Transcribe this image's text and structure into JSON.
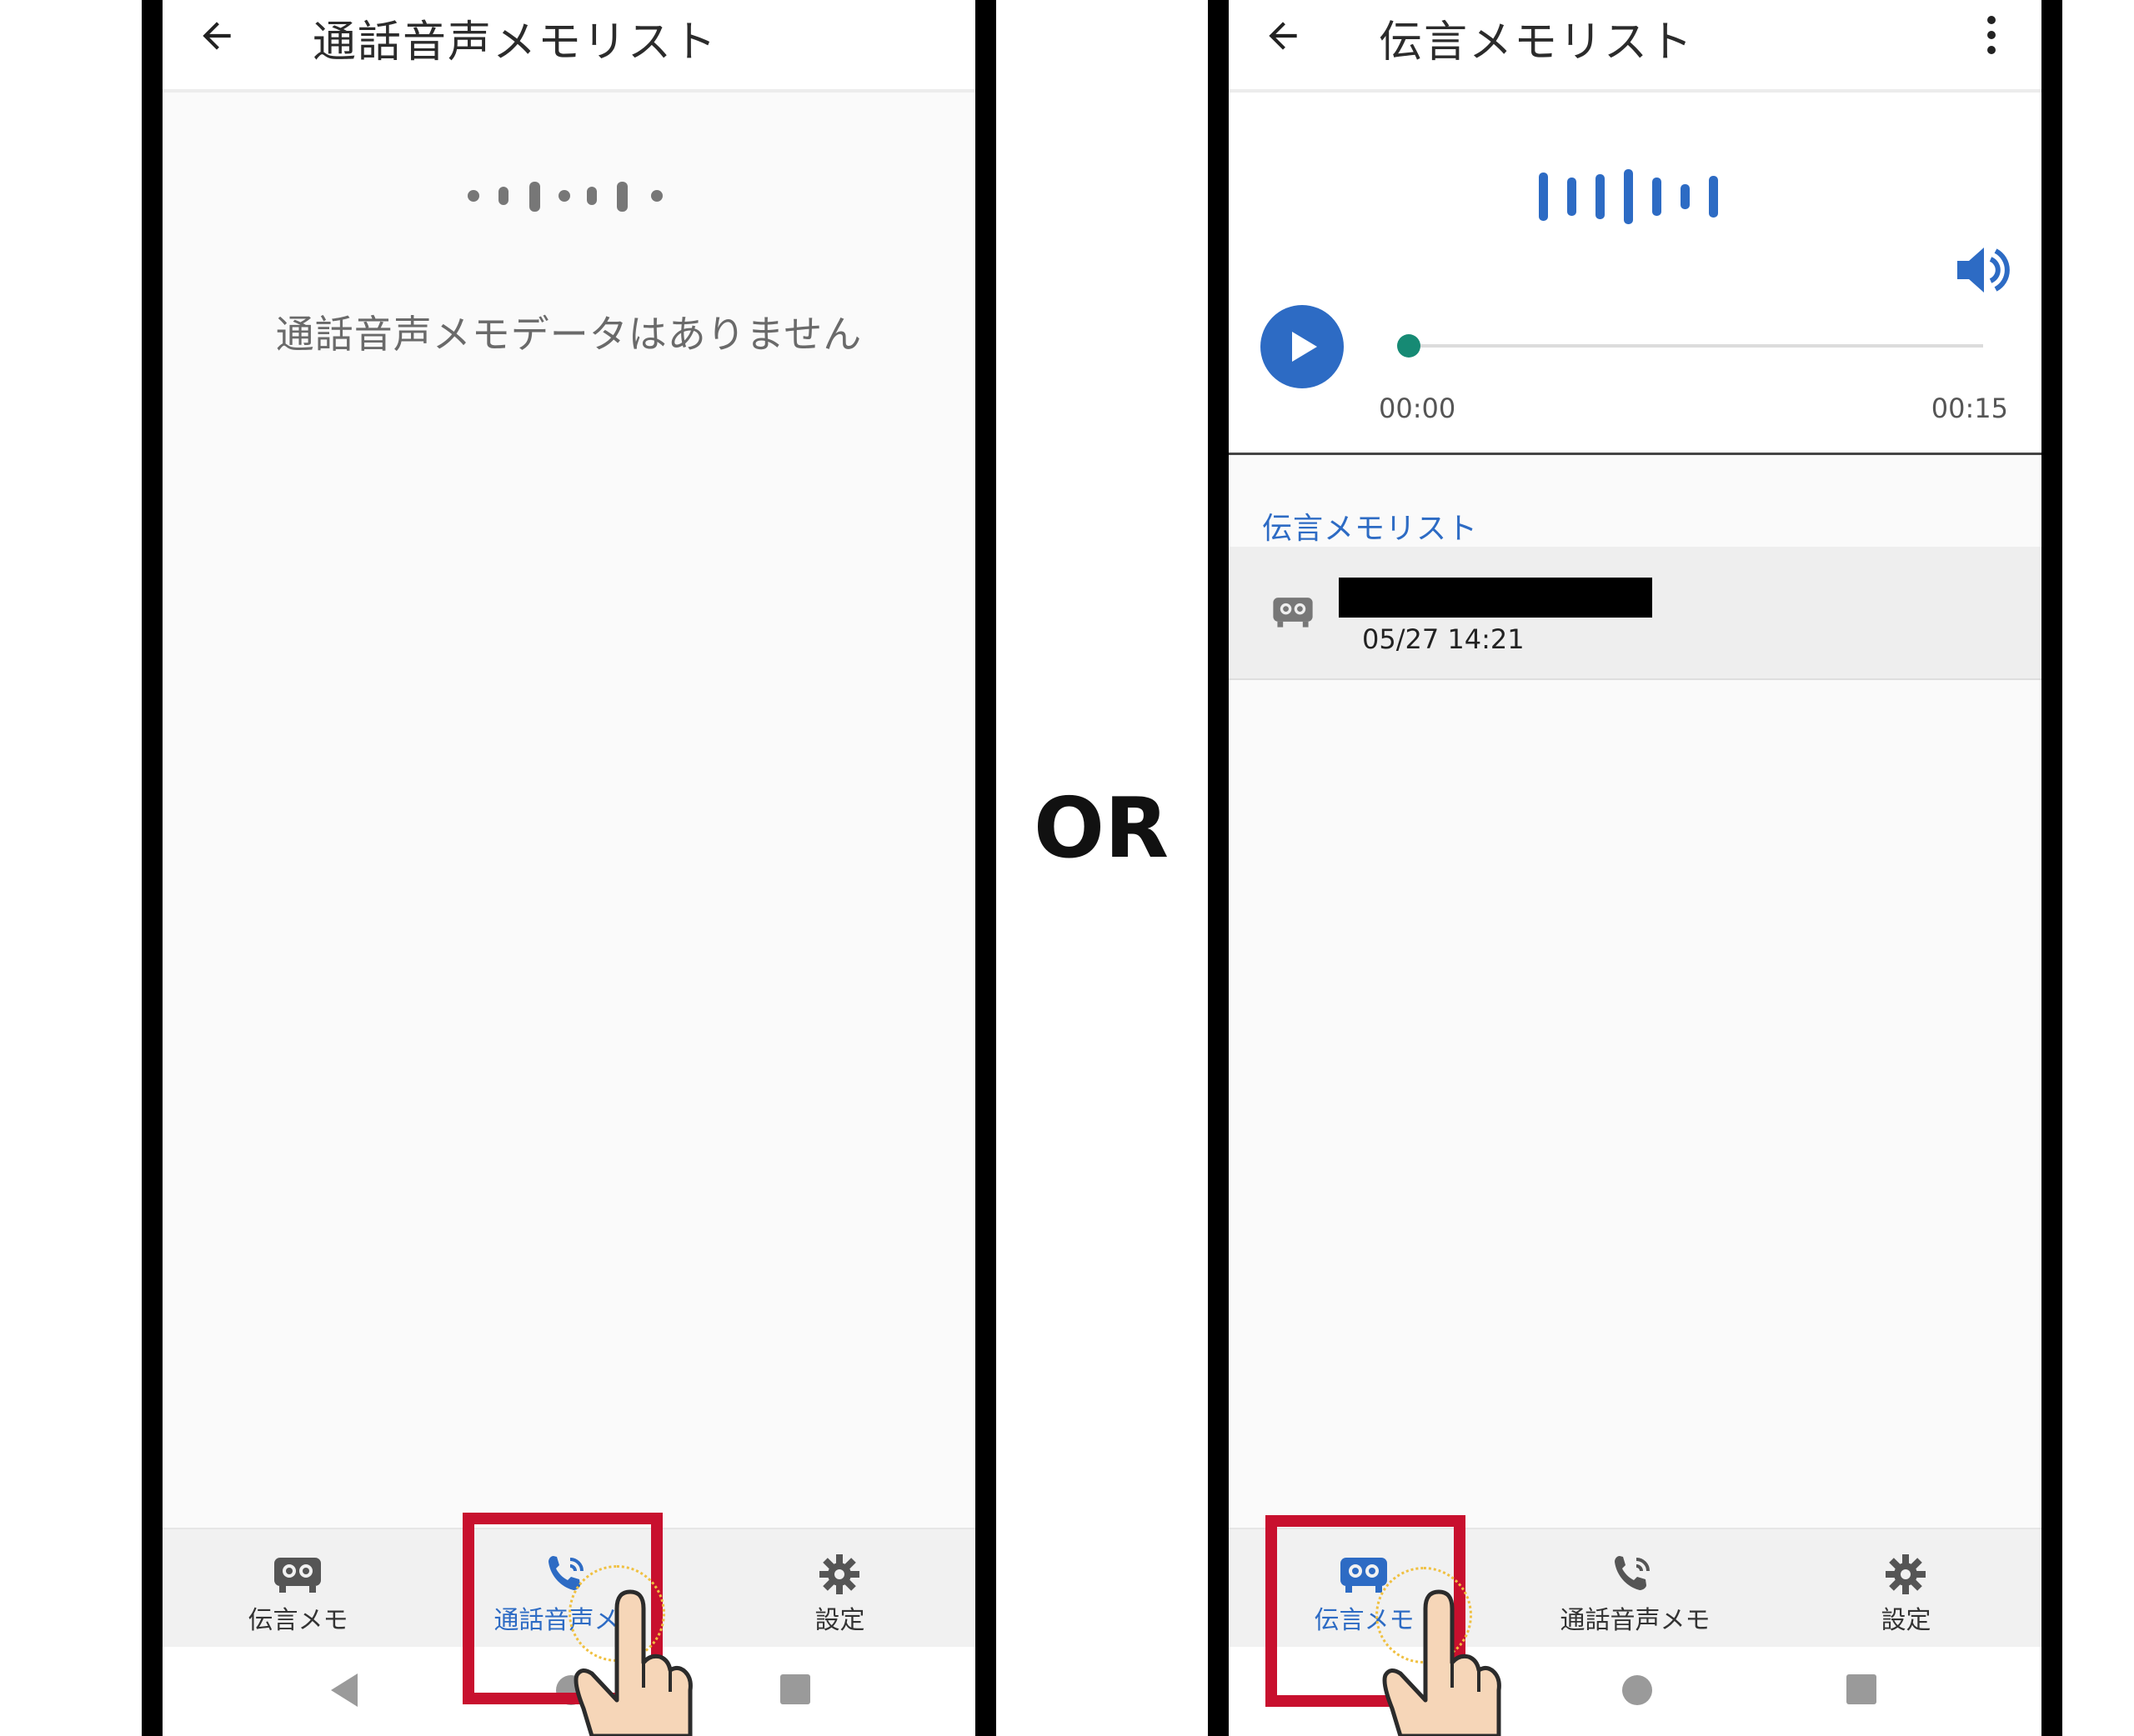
{
  "left_screen": {
    "appbar": {
      "title": "通話音声メモリスト"
    },
    "empty_message": "通話音声メモデータはありません",
    "bottom_nav": [
      {
        "label": "伝言メモ",
        "icon": "voicemail-icon",
        "active": false
      },
      {
        "label": "通話音声メモ",
        "icon": "phone-recording-icon",
        "active": true
      },
      {
        "label": "設定",
        "icon": "gear-icon",
        "active": false
      }
    ]
  },
  "separator_label": "OR",
  "right_screen": {
    "appbar": {
      "title": "伝言メモリスト"
    },
    "player": {
      "time_start": "00:00",
      "time_end": "00:15",
      "progress": 0
    },
    "section_header": "伝言メモリスト",
    "list": [
      {
        "datetime": "05/27 14:21"
      }
    ],
    "bottom_nav": [
      {
        "label": "伝言メモ",
        "icon": "voicemail-icon",
        "active": true
      },
      {
        "label": "通話音声メモ",
        "icon": "phone-recording-icon",
        "active": false
      },
      {
        "label": "設定",
        "icon": "gear-icon",
        "active": false
      }
    ]
  },
  "colors": {
    "accent_blue": "#2d6bc4",
    "highlight_red": "#c8102e",
    "seek_thumb": "#168a74"
  }
}
